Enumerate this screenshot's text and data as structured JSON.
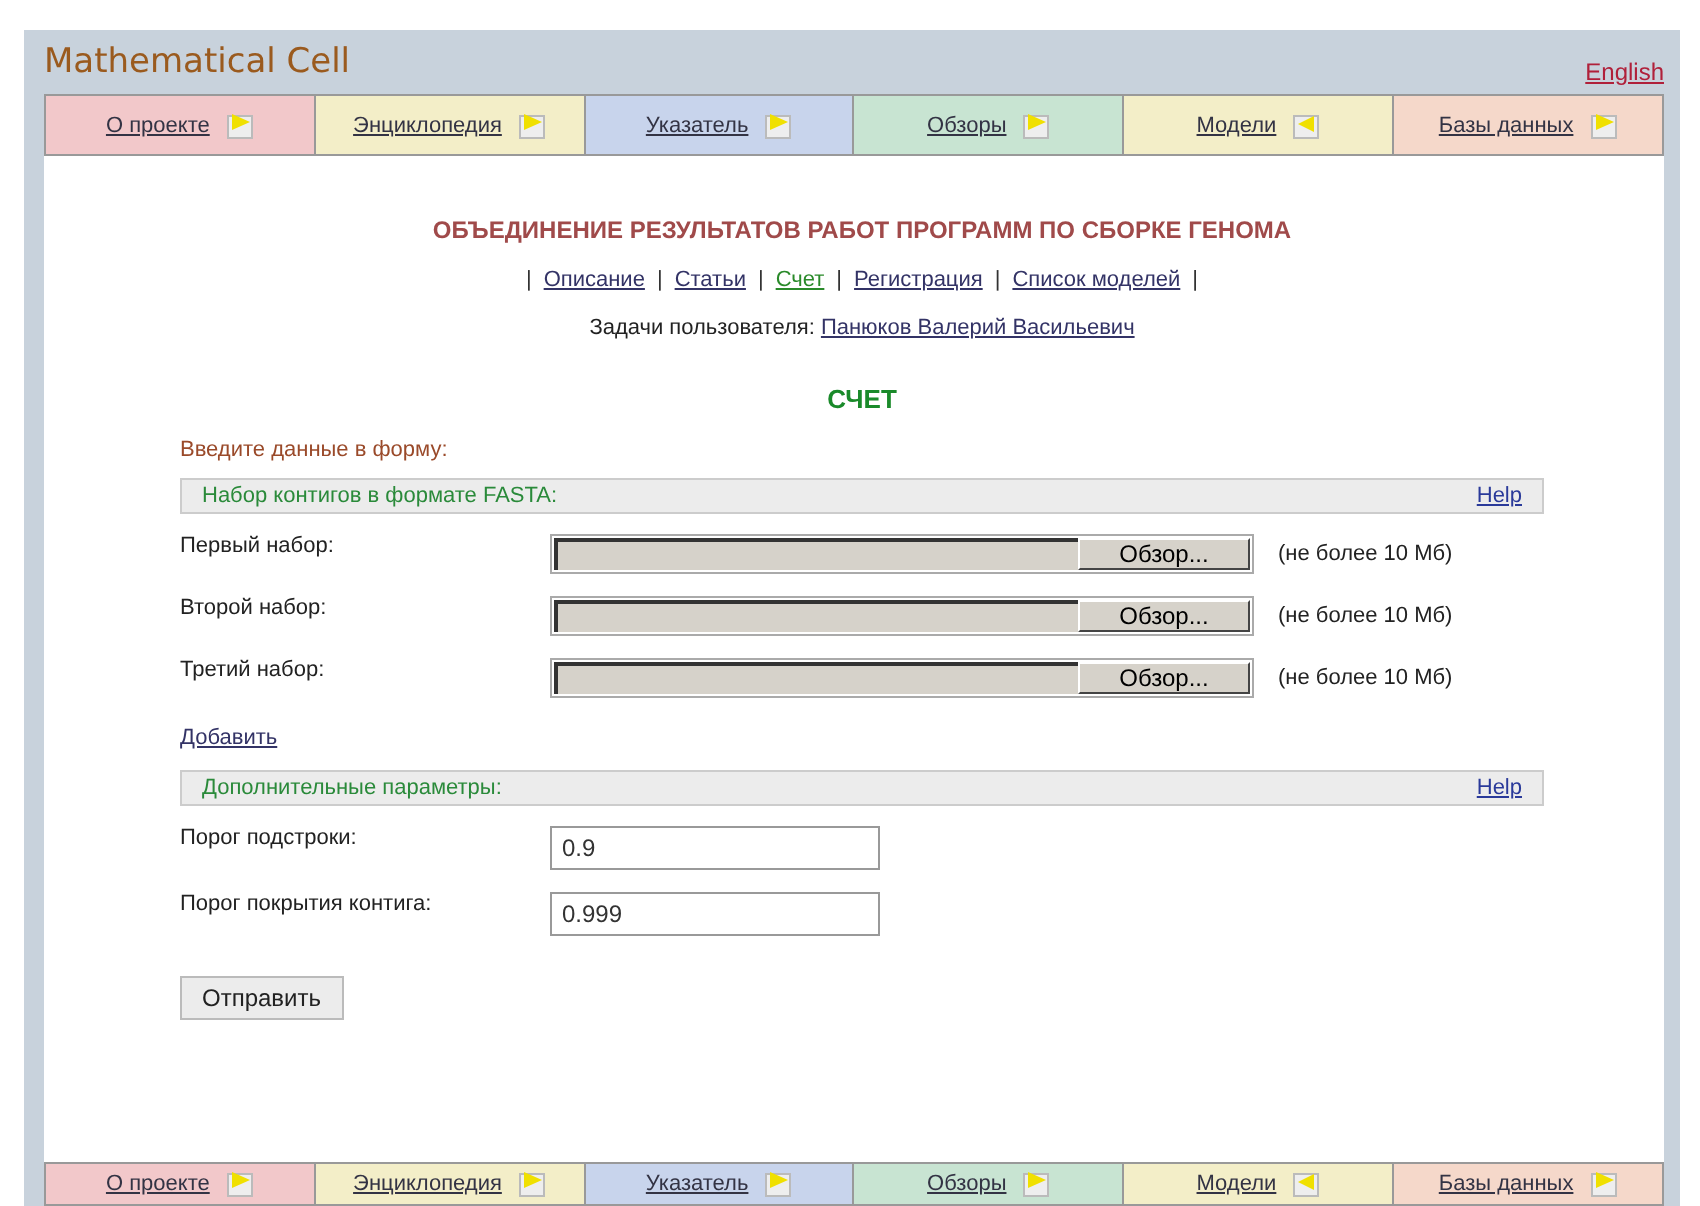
{
  "site_title": "Mathematical Cell",
  "language_link": "English",
  "tabs": [
    {
      "label": "О проекте",
      "color": "#f2c8ca",
      "kind": "forward"
    },
    {
      "label": "Энциклопедия",
      "color": "#f3eec8",
      "kind": "forward"
    },
    {
      "label": "Указатель",
      "color": "#c8d4ec",
      "kind": "forward"
    },
    {
      "label": "Обзоры",
      "color": "#c8e4d2",
      "kind": "forward"
    },
    {
      "label": "Модели",
      "color": "#f3eec8",
      "kind": "back"
    },
    {
      "label": "Базы данных",
      "color": "#f5d8ca",
      "kind": "forward"
    }
  ],
  "bottom_tabs": [
    {
      "label": "О проекте",
      "color": "#f2c8ca",
      "kind": "forward"
    },
    {
      "label": "Энциклопедия",
      "color": "#f3eec8",
      "kind": "forward"
    },
    {
      "label": "Указатель",
      "color": "#c8d4ec",
      "kind": "forward"
    },
    {
      "label": "Обзоры",
      "color": "#c8e4d2",
      "kind": "forward"
    },
    {
      "label": "Модели",
      "color": "#f3eec8",
      "kind": "back"
    },
    {
      "label": "Базы данных",
      "color": "#f5d8ca",
      "kind": "forward"
    }
  ],
  "sub_nav_separators": [
    "|",
    "|",
    "|",
    "|",
    "|",
    "|"
  ],
  "heading": "ОБЪЕДИНЕНИЕ РЕЗУЛЬТАТОВ РАБОТ ПРОГРАММ ПО СБОРКЕ ГЕНОМА",
  "sub_nav": [
    {
      "label": "Описание",
      "selected": false
    },
    {
      "label": "Статьи",
      "selected": false
    },
    {
      "label": "Счет",
      "selected": true
    },
    {
      "label": "Регистрация",
      "selected": false
    },
    {
      "label": "Список моделей",
      "selected": false
    }
  ],
  "user_label": "Задачи пользователя:",
  "user_name": "Панюков Валерий Васильевич",
  "page_title": "СЧЕТ",
  "intro": "Введите данные в форму:",
  "fasta_section": {
    "title": "Набор контигов в формате FASTA:",
    "help": "Help"
  },
  "file_rows": [
    {
      "label": "Первый набор:",
      "button": "Обзор...",
      "note": "(не более 10 Мб)"
    },
    {
      "label": "Второй набор:",
      "button": "Обзор...",
      "note": "(не более 10 Мб)"
    },
    {
      "label": "Третий набор:",
      "button": "Обзор...",
      "note": "(не более 10 Мб)"
    }
  ],
  "add_link": "Добавить",
  "params_section": {
    "title": "Дополнительные параметры:",
    "help": "Help"
  },
  "params": [
    {
      "label": "Порог подстроки:",
      "value": "0.9"
    },
    {
      "label": "Порог покрытия контига:",
      "value": "0.999"
    }
  ],
  "submit": "Отправить"
}
